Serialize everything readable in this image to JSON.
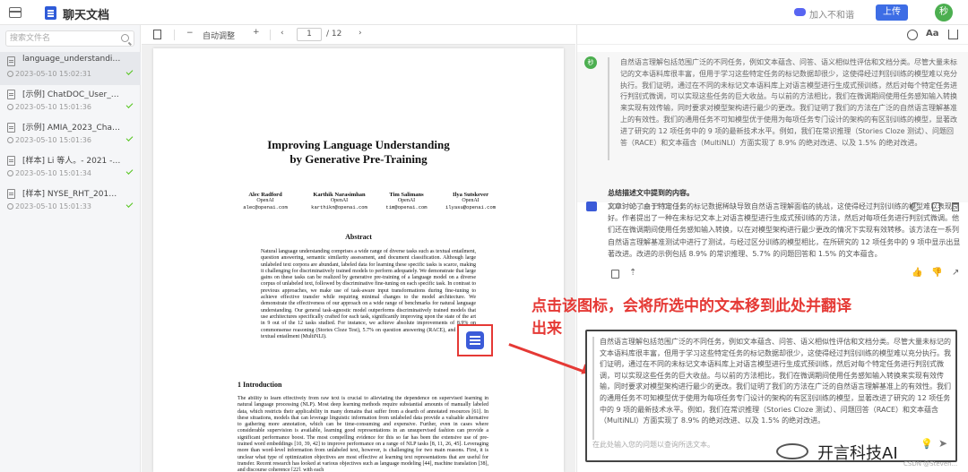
{
  "app": {
    "title": "聊天文档",
    "discord_label": "加入不和谐",
    "upload_label": "上传",
    "avatar_text": "秒"
  },
  "sidebar": {
    "search_placeholder": "搜索文件名",
    "items": [
      {
        "name": "language_understanding_pap...",
        "time": "2023-05-10 15:02:31",
        "active": true
      },
      {
        "name": "[示例] ChatDOC_User_Guide...",
        "time": "2023-05-10 15:01:36",
        "active": false
      },
      {
        "name": "[示例] AMIA_2023_ChatGPT...",
        "time": "2023-05-10 15:01:36",
        "active": false
      },
      {
        "name": "[样本] Li 等人。- 2021 - SelfD...",
        "time": "2023-05-10 15:01:34",
        "active": false
      },
      {
        "name": "[样本] NYSE_RHT_2019_Ann...",
        "time": "2023-05-10 15:01:33",
        "active": false
      }
    ]
  },
  "viewer": {
    "zoom_label": "自动调整",
    "minus": "−",
    "plus": "+",
    "page_current": "1",
    "page_total": "/ 12",
    "prev": "‹",
    "next": "›"
  },
  "paper": {
    "title_line1": "Improving Language Understanding",
    "title_line2": "by Generative Pre-Training",
    "authors": [
      {
        "name": "Alec Radford",
        "org": "OpenAI",
        "email": "alec@openai.com"
      },
      {
        "name": "Karthik Narasimhan",
        "org": "OpenAI",
        "email": "karthikn@openai.com"
      },
      {
        "name": "Tim Salimans",
        "org": "OpenAI",
        "email": "tim@openai.com"
      },
      {
        "name": "Ilya Sutskever",
        "org": "OpenAI",
        "email": "ilyasu@openai.com"
      }
    ],
    "abstract_title": "Abstract",
    "abstract": "Natural language understanding comprises a wide range of diverse tasks such as textual entailment, question answering, semantic similarity assessment, and document classification. Although large unlabeled text corpora are abundant, labeled data for learning these specific tasks is scarce, making it challenging for discriminatively trained models to perform adequately. We demonstrate that large gains on these tasks can be realized by generative pre-training of a language model on a diverse corpus of unlabeled text, followed by discriminative fine-tuning on each specific task. In contrast to previous approaches, we make use of task-aware input transformations during fine-tuning to achieve effective transfer while requiring minimal changes to the model architecture. We demonstrate the effectiveness of our approach on a wide range of benchmarks for natural language understanding. Our general task-agnostic model outperforms discriminatively trained models that use architectures specifically crafted for each task, significantly improving upon the state of the art in 9 out of the 12 tasks studied. For instance, we achieve absolute improvements of 8.9% on commonsense reasoning (Stories Cloze Test), 5.7% on question answering (RACE), and 1.5% on textual entailment (MultiNLI).",
    "intro_title": "1     Introduction",
    "intro": "The ability to learn effectively from raw text is crucial to alleviating the dependence on supervised learning in natural language processing (NLP). Most deep learning methods require substantial amounts of manually labeled data, which restricts their applicability in many domains that suffer from a dearth of annotated resources [61]. In these situations, models that can leverage linguistic information from unlabeled data provide a valuable alternative to gathering more annotation, which can be time-consuming and expensive. Further, even in cases where considerable supervision is available, learning good representations in an unsupervised fashion can provide a significant performance boost. The most compelling evidence for this so far has been the extensive use of pre-trained word embeddings [10, 39, 42] to improve performance on a range of NLP tasks [8, 11, 26, 45]. Leveraging more than word-level information from unlabeled text, however, is challenging for two main reasons. First, it is unclear what type of optimization objectives are most effective at learning text representations that are useful for transfer. Recent research has looked at various objectives such as language modeling [44], machine translation [38], and discourse coherence [22], with each"
  },
  "chat": {
    "user_avatar": "秒",
    "user_quote": "自然语言理解包括范围广泛的不同任务，例如文本蕴含、问答、语义相似性评估和文档分类。尽管大量未标记的文本语料库很丰富，但用于学习这些特定任务的标记数据却很少，这使得经过判别训练的模型难以充分执行。我们证明，通过在不同的未标记文本语料库上对语言模型进行生成式预训练，然后对每个特定任务进行判别式微调，可以实现这些任务的巨大收益。与以前的方法相比，我们在微调期间使用任务感知输入转换来实现有效传输，同时要求对模型架构进行最少的更改。我们证明了我们的方法在广泛的自然语言理解基准上的有效性。我们的通用任务不可知模型优于使用为每项任务专门设计的架构的有区别训练的模型，显著改进了研究的 12 项任务中的 9 项的最新技术水平。例如，我们在常识推理（Stories Cloze 测试）、问题回答（RACE）和文本蕴含（MultiNLI）方面实现了 8.9% 的绝对改进、以及 1.5% 的绝对改进。",
    "user_question": "总结描述文中提到的内容。",
    "user_time": "2023-05-10 15:08:31",
    "ai_answer": "文章讨论了由于特定任务的标记数据稀缺导致自然语言理解面临的挑战，这使得经过判别训练的模型难以表现良好。作者提出了一种在未标记文本上对语言模型进行生成式预训练的方法，然后对每项任务进行判别式微调。他们还在微调期间使用任务感知输入转换，以在对模型架构进行最少更改的情况下实现有效转移。该方法在一系列自然语言理解基准测试中进行了测试，与经过区分训练的模型相比，在所研究的 12 项任务中的 9 项中显示出显著改进。改进的示例包括 8.9% 的常识推理、5.7% 的问题回答和 1.5% 的文本蕴含。",
    "callout_text": "点击该图标，会将所选中的文本移到此处并翻译出来",
    "input_quote": "自然语言理解包括范围广泛的不同任务，例如文本蕴含、问答、语义相似性评估和文档分类。尽管大量未标记的文本语料库很丰富，但用于学习这些特定任务的标记数据却很少，这使得经过判别训练的模型难以充分执行。我们证明，通过在不同的未标记文本语料库上对语言模型进行生成式预训练，然后对每个特定任务进行判别式微调，可以实现这些任务的巨大收益。与以前的方法相比，我们在微调期间使用任务感知输入转换来实现有效传输，同时要求对模型架构进行最少的更改。我们证明了我们的方法在广泛的自然语言理解基准上的有效性。我们的通用任务不可知模型优于使用为每项任务专门设计的架构的有区别训练的模型，显著改进了研究的 12 项任务中的 9 项的最新技术水平。例如，我们在常识推理（Stories Cloze 测试）、问题回答（RACE）和文本蕴含（MultiNLI）方面实现了 8.9% 的绝对改进、以及 1.5% 的绝对改进。",
    "input_placeholder": "在此处输入您的问题以查询所选文本。"
  },
  "watermark": {
    "text": "开言科技AI",
    "credit": "CSDN @Steven..."
  },
  "colors": {
    "accent": "#3d6de5",
    "callout": "#e53935",
    "avatar": "#4caf50"
  }
}
